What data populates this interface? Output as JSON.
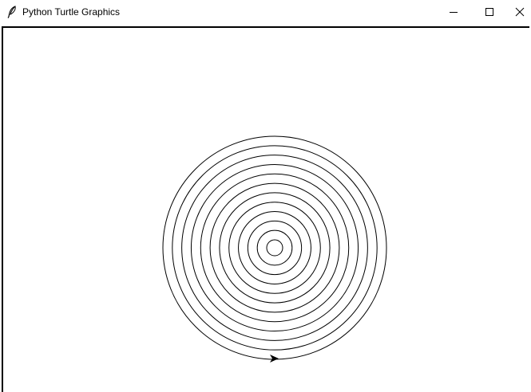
{
  "window": {
    "title": "Python Turtle Graphics",
    "icon": "feather-icon",
    "controls": [
      "minimize-icon",
      "maximize-icon",
      "close-icon"
    ]
  },
  "drawing": {
    "shape": "concentric circles",
    "circle_count": 12,
    "stroke_color": "#000000",
    "background_color": "#ffffff",
    "turtle_color": "#000000",
    "turtle_heading": "east"
  }
}
